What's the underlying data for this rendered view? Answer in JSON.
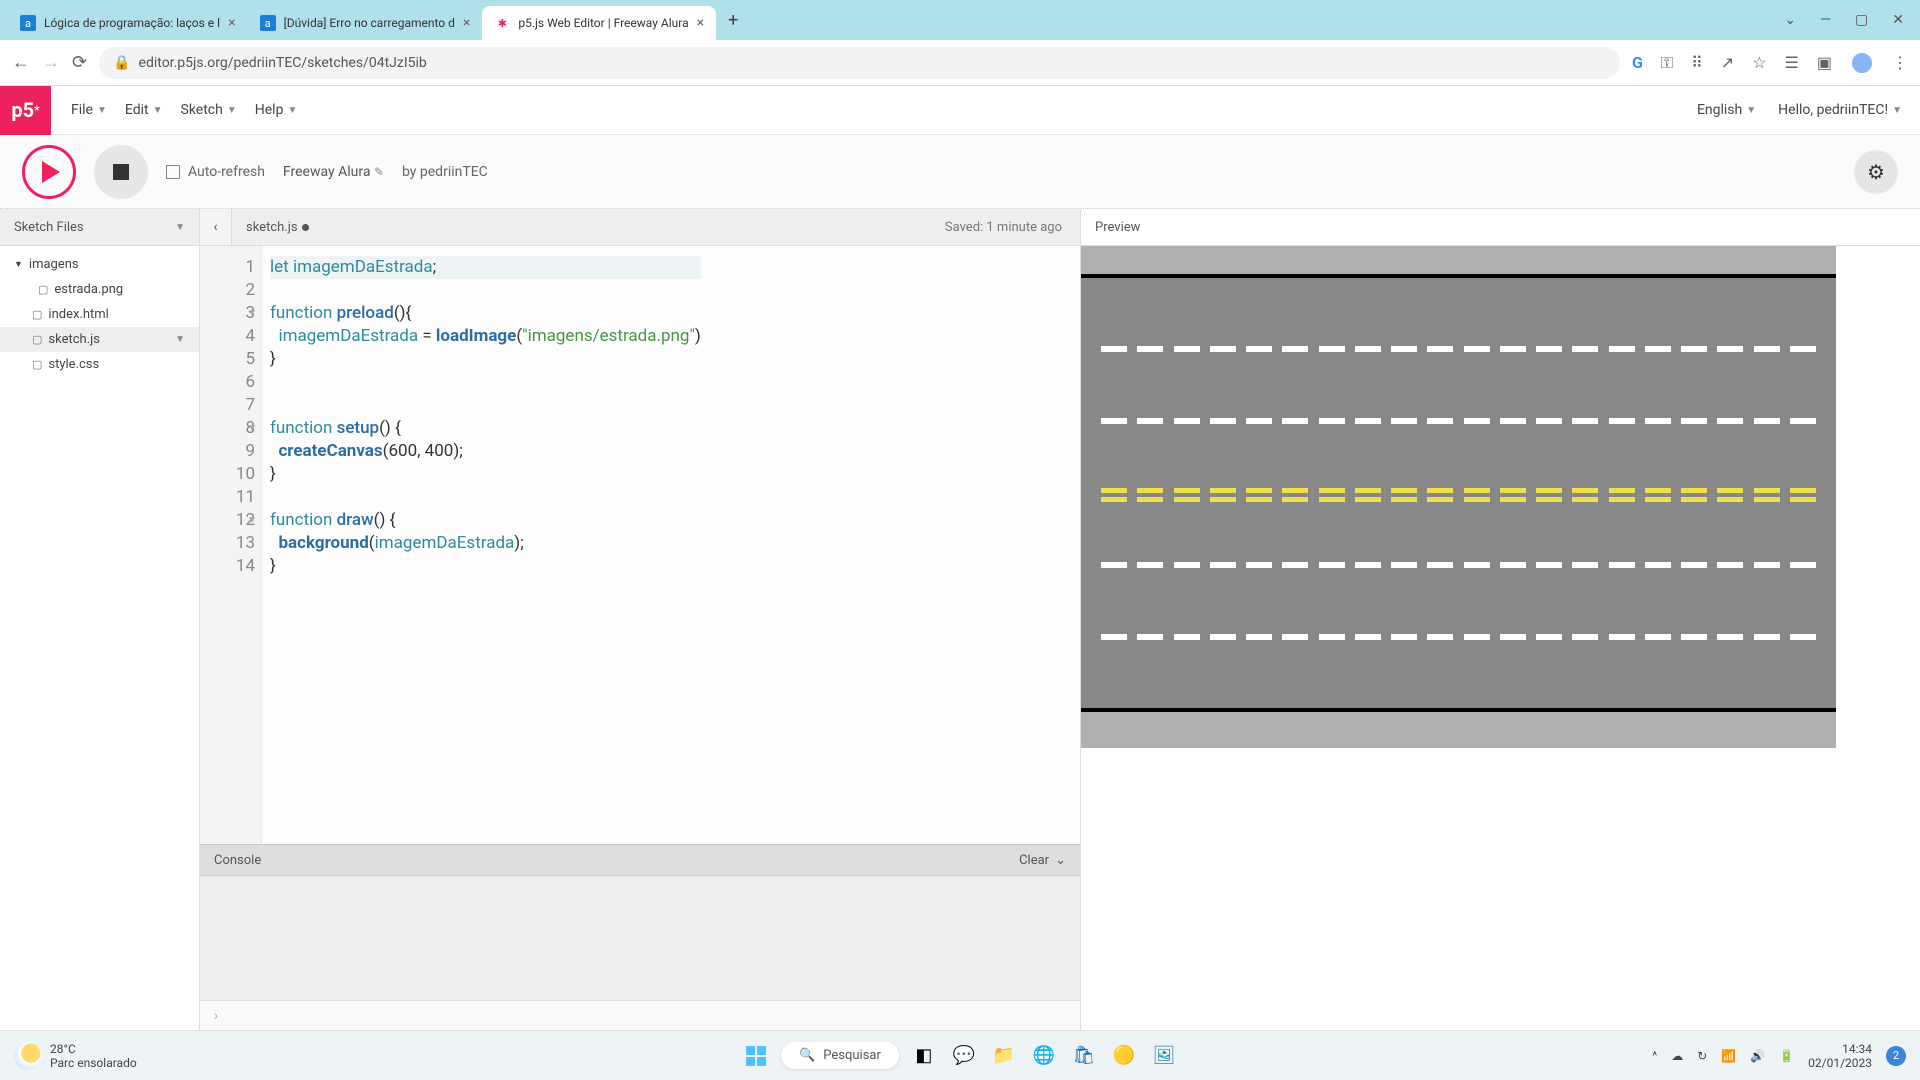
{
  "browser": {
    "tabs": [
      {
        "favicon": "a",
        "favicon_bg": "#1b80d4",
        "title": "Lógica de programação: laços e l"
      },
      {
        "favicon": "a",
        "favicon_bg": "#1b80d4",
        "title": "[Dúvida] Erro no carregamento d"
      },
      {
        "favicon": "✱",
        "favicon_bg": "#ed225d",
        "title": "p5.js Web Editor | Freeway Alura"
      }
    ],
    "url": "editor.p5js.org/pedriinTEC/sketches/04tJzI5ib"
  },
  "p5menu": {
    "file": "File",
    "edit": "Edit",
    "sketch": "Sketch",
    "help": "Help",
    "lang": "English",
    "hello": "Hello, pedriinTEC!"
  },
  "controls": {
    "autorefresh": "Auto-refresh",
    "sketch_name": "Freeway Alura",
    "author_prefix": "by ",
    "author": "pedriinTEC"
  },
  "sidebar": {
    "title": "Sketch Files",
    "folder": "imagens",
    "files": [
      "estrada.png",
      "index.html",
      "sketch.js",
      "style.css"
    ]
  },
  "editor": {
    "filename": "sketch.js",
    "saved": "Saved: 1 minute ago",
    "console": "Console",
    "clear": "Clear",
    "prompt": "›"
  },
  "preview": {
    "title": "Preview"
  },
  "taskbar": {
    "temp": "28°C",
    "desc": "Parc ensolarado",
    "search": "Pesquisar",
    "time": "14:34",
    "date": "02/01/2023",
    "notif": "2"
  },
  "code": {
    "l1_kw": "let ",
    "l1_var": "imagemDaEstrada",
    "l1_end": ";",
    "l3_kw": "function ",
    "l3_fn": "preload",
    "l3_end": "(){",
    "l4_pad": "  ",
    "l4_var": "imagemDaEstrada",
    "l4_eq": " = ",
    "l4_bi": "loadImage",
    "l4_p1": "(",
    "l4_str": "\"imagens/estrada.png\"",
    "l4_p2": ")",
    "l5": "}",
    "l8_kw": "function ",
    "l8_fn": "setup",
    "l8_end": "() {",
    "l9_pad": "  ",
    "l9_bi": "createCanvas",
    "l9_args": "(600, 400);",
    "l10": "}",
    "l12_kw": "function ",
    "l12_fn": "draw",
    "l12_end": "() {",
    "l13_pad": "  ",
    "l13_bi": "background",
    "l13_p1": "(",
    "l13_var": "imagemDaEstrada",
    "l13_p2": ");",
    "l14": "}"
  }
}
